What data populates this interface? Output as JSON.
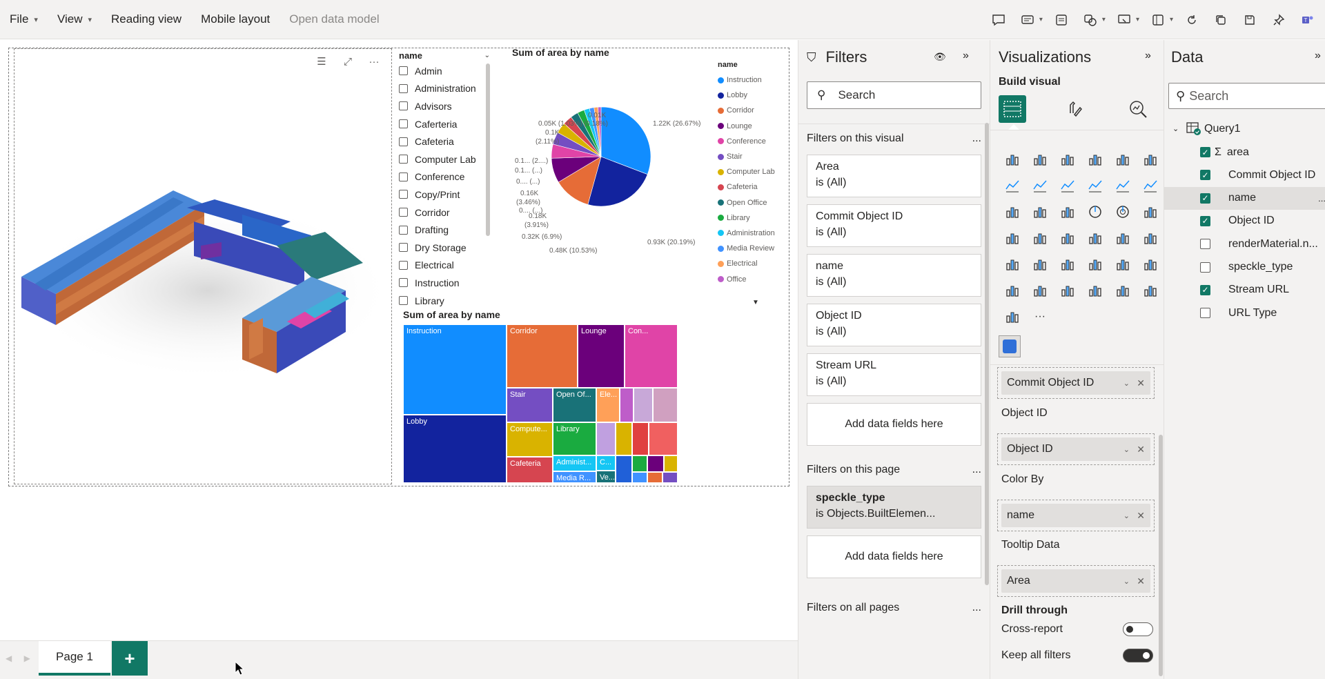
{
  "ribbon": {
    "menus": [
      {
        "label": "File"
      },
      {
        "label": "View"
      },
      {
        "label": "Reading view"
      },
      {
        "label": "Mobile layout"
      },
      {
        "label": "Open data model"
      }
    ],
    "icons": [
      "comment-icon",
      "format-icon",
      "text-icon",
      "shapes-icon",
      "present-icon",
      "layout-icon",
      "refresh-icon",
      "copy-icon",
      "save-icon",
      "pin-icon",
      "teams-icon"
    ]
  },
  "slicer": {
    "title": "name",
    "items": [
      "Admin",
      "Administration",
      "Advisors",
      "Caferteria",
      "Cafeteria",
      "Computer Lab",
      "Conference",
      "Copy/Print",
      "Corridor",
      "Drafting",
      "Dry Storage",
      "Electrical",
      "Instruction",
      "Library"
    ]
  },
  "chart_data": [
    {
      "type": "pie",
      "title": "Sum of area by name",
      "legend_title": "name",
      "legend_placement": "right",
      "categories": [
        "Instruction",
        "Lobby",
        "Corridor",
        "Lounge",
        "Conference",
        "Stair",
        "Computer Lab",
        "Cafeteria",
        "Open Office",
        "Library",
        "Administration",
        "Media Review",
        "Electrical",
        "Office"
      ],
      "values": [
        1.22,
        0.93,
        0.48,
        0.32,
        0.18,
        0.16,
        0.14,
        0.12,
        0.1,
        0.09,
        0.07,
        0.06,
        0.05,
        0.04
      ],
      "unit": "K",
      "data_labels": {
        "instruction": "1.22K (26.67%)",
        "lobby": "0.93K (20.19%)",
        "corridor": "0.48K (10.53%)",
        "lounge": "0.32K (6.9%)",
        "l5": "0.18K",
        "l5p": "(3.91%)",
        "l6": "0.16K",
        "l6p": "(3.46%)",
        "l7": "0.... (...)",
        "l8": "0.... (...)",
        "l9": "0.1... (...)",
        "l10": "0.1... (2....)",
        "l11": "0.1K",
        "l11p": "(2.11%)",
        "l12": "0.05K (1.03%)",
        "l13": "0.01K",
        "l13p": "(0.18%)"
      },
      "colors": [
        "#118DFF",
        "#12239E",
        "#E66C37",
        "#6B007B",
        "#E044A7",
        "#744EC2",
        "#D9B300",
        "#D64550",
        "#197278",
        "#1AAB40",
        "#15C6F4",
        "#4092FF",
        "#FFA058",
        "#BE5DC9"
      ]
    },
    {
      "type": "treemap",
      "title": "Sum of area by name",
      "labels": [
        "Instruction",
        "Lobby",
        "Corridor",
        "Lounge",
        "Con...",
        "Stair",
        "Compute...",
        "Cafeteria",
        "Open Of...",
        "Library",
        "Administ...",
        "Media R...",
        "Ele...",
        "C...",
        "Ve..."
      ]
    }
  ],
  "pages": {
    "tab": "Page 1",
    "add": "+"
  },
  "filters": {
    "title": "Filters",
    "search_placeholder": "Search",
    "on_visual_label": "Filters on this visual",
    "visual_filters": [
      {
        "name": "Area",
        "value": "is (All)"
      },
      {
        "name": "Commit Object ID",
        "value": "is (All)"
      },
      {
        "name": "name",
        "value": "is (All)"
      },
      {
        "name": "Object ID",
        "value": "is (All)"
      },
      {
        "name": "Stream URL",
        "value": "is (All)"
      }
    ],
    "add_fields": "Add data fields here",
    "on_page_label": "Filters on this page",
    "page_filter": {
      "name": "speckle_type",
      "value": "is Objects.BuiltElemen..."
    },
    "on_all_pages_label": "Filters on all pages",
    "more": "..."
  },
  "visualizations": {
    "title": "Visualizations",
    "build_visual": "Build visual",
    "wells": [
      {
        "label": "",
        "field": "Commit Object ID"
      },
      {
        "label": "Object ID",
        "field": "Object ID"
      },
      {
        "label": "Color By",
        "field": "name"
      },
      {
        "label": "Tooltip Data",
        "field": "Area"
      }
    ],
    "drill_through": "Drill through",
    "cross_report": "Cross-report",
    "keep_all_filters": "Keep all filters",
    "cross_report_on": false,
    "keep_all_filters_on": true
  },
  "data_pane": {
    "title": "Data",
    "search_placeholder": "Search",
    "table": "Query1",
    "fields": [
      {
        "name": "area",
        "checked": true,
        "sigma": "Σ"
      },
      {
        "name": "Commit Object ID",
        "checked": true
      },
      {
        "name": "name",
        "checked": true
      },
      {
        "name": "Object ID",
        "checked": true
      },
      {
        "name": "renderMaterial.n...",
        "checked": false
      },
      {
        "name": "speckle_type",
        "checked": false
      },
      {
        "name": "Stream URL",
        "checked": true
      },
      {
        "name": "URL Type",
        "checked": false
      }
    ],
    "row_more": "..."
  }
}
